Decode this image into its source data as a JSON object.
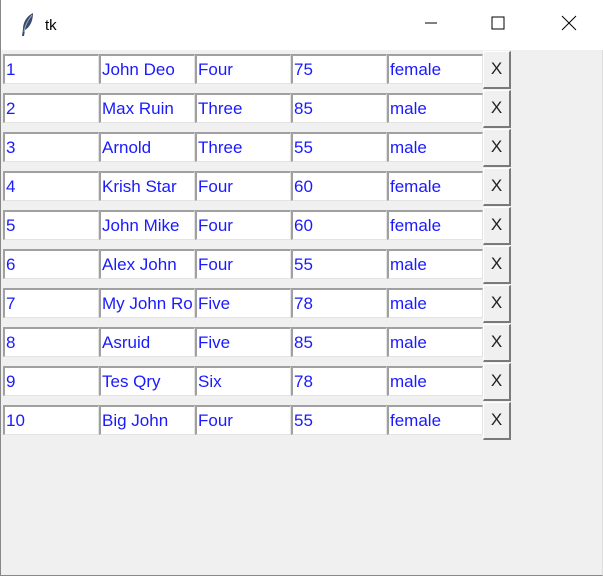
{
  "window": {
    "title": "tk",
    "icon": "feather-icon",
    "controls": [
      "minimize-icon",
      "maximize-icon",
      "close-icon"
    ]
  },
  "colors": {
    "cell_text": "#1a1aff",
    "background": "#f0f0f0"
  },
  "rows": [
    {
      "cells": [
        "1",
        "John Deo",
        "Four",
        "75",
        "female"
      ],
      "button": "X"
    },
    {
      "cells": [
        "2",
        "Max Ruin",
        "Three",
        "85",
        "male"
      ],
      "button": "X"
    },
    {
      "cells": [
        "3",
        "Arnold",
        "Three",
        "55",
        "male"
      ],
      "button": "X"
    },
    {
      "cells": [
        "4",
        "Krish Star",
        "Four",
        "60",
        "female"
      ],
      "button": "X"
    },
    {
      "cells": [
        "5",
        "John Mike",
        "Four",
        "60",
        "female"
      ],
      "button": "X"
    },
    {
      "cells": [
        "6",
        "Alex John",
        "Four",
        "55",
        "male"
      ],
      "button": "X"
    },
    {
      "cells": [
        "7",
        "My John Ro",
        "Five",
        "78",
        "male"
      ],
      "button": "X"
    },
    {
      "cells": [
        "8",
        "Asruid",
        "Five",
        "85",
        "male"
      ],
      "button": "X"
    },
    {
      "cells": [
        "9",
        "Tes Qry",
        "Six",
        "78",
        "male"
      ],
      "button": "X"
    },
    {
      "cells": [
        "10",
        "Big John",
        "Four",
        "55",
        "female"
      ],
      "button": "X"
    }
  ]
}
